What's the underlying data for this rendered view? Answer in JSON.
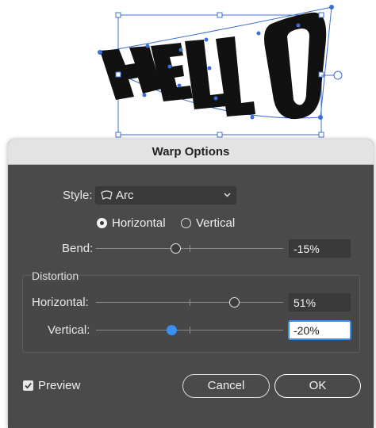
{
  "artwork": {
    "text": "HELLO"
  },
  "dialog": {
    "title": "Warp Options",
    "style": {
      "label": "Style:",
      "value": "Arc",
      "icon": "arc-warp-icon"
    },
    "orientation": {
      "options": [
        {
          "label": "Horizontal",
          "selected": true
        },
        {
          "label": "Vertical",
          "selected": false
        }
      ]
    },
    "bend": {
      "label": "Bend:",
      "value": "-15%",
      "percent": -15
    },
    "distortion": {
      "label": "Distortion",
      "horizontal": {
        "label": "Horizontal:",
        "value": "51%",
        "percent": 51
      },
      "vertical": {
        "label": "Vertical:",
        "value": "-20%",
        "percent": -20
      }
    },
    "preview": {
      "label": "Preview",
      "checked": true
    },
    "buttons": {
      "cancel": "Cancel",
      "ok": "OK"
    }
  },
  "colors": {
    "accent": "#3b8ef2",
    "dialog_bg": "#4a4a4a",
    "selection": "#3b6fd4"
  }
}
